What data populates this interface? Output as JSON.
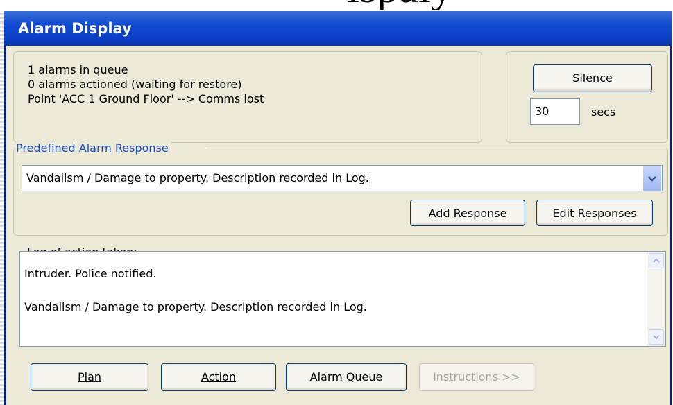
{
  "backdrop_caption": "ispaly",
  "window": {
    "title": "Alarm Display"
  },
  "status": {
    "line1": "1 alarms in queue",
    "line2": "0 alarms actioned (waiting for restore)",
    "line3": "Point 'ACC 1 Ground Floor' --> Comms lost"
  },
  "silence": {
    "button_label": "Silence",
    "seconds_value": "30",
    "seconds_unit": "secs"
  },
  "response": {
    "legend": "Predefined Alarm Response",
    "selected": "Vandalism / Damage to property. Description recorded in Log.",
    "add_label": "Add Response",
    "edit_label": "Edit Responses"
  },
  "log": {
    "label": "Log of action taken:",
    "entries": [
      "Intruder. Police notified.",
      "Vandalism / Damage to property. Description recorded in Log."
    ]
  },
  "footer": {
    "plan_label": "Plan",
    "action_label": "Action",
    "queue_label": "Alarm Queue",
    "instructions_label": "Instructions >>"
  },
  "icons": {
    "combo_arrow": "chevron-down-icon",
    "scroll_up": "scroll-up-icon",
    "scroll_down": "scroll-down-icon"
  },
  "colors": {
    "titlebar": "#0b3fc4",
    "window_bg": "#ece9d8",
    "legend_text": "#1b4eb5"
  }
}
